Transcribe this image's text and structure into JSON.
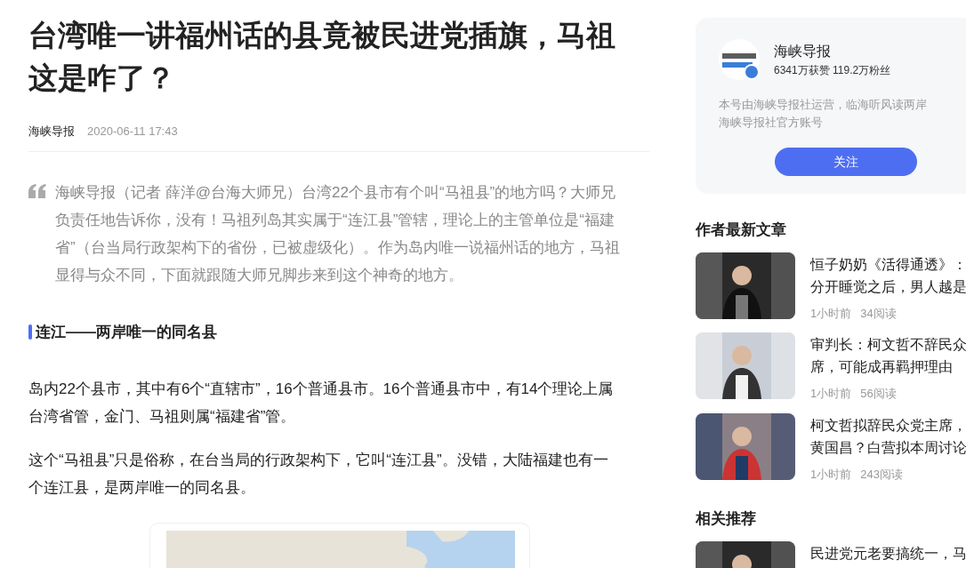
{
  "article": {
    "title": "台湾唯一讲福州话的县竟被民进党插旗，马祖这是咋了？",
    "source": "海峡导报",
    "time": "2020-06-11 17:43",
    "quote": "海峡导报（记者 薛洋@台海大师兄）台湾22个县市有个叫“马祖县”的地方吗？大师兄负责任地告诉你，没有！马祖列岛其实属于“连江县”管辖，理论上的主管单位是“福建省”（台当局行政架构下的省份，已被虚级化）。作为岛内唯一说福州话的地方，马祖显得与众不同，下面就跟随大师兄脚步来到这个神奇的地方。",
    "blocks": [
      {
        "kind": "heading",
        "text": "连江——两岸唯一的同名县"
      },
      {
        "kind": "paragraph",
        "text": "岛内22个县市，其中有6个“直辖市”，16个普通县市。16个普通县市中，有14个理论上属台湾省管，金门、马祖则属“福建省”管。"
      },
      {
        "kind": "paragraph",
        "text": "这个“马祖县”只是俗称，在台当局的行政架构下，它叫“连江县”。没错，大陆福建也有一个连江县，是两岸唯一的同名县。"
      },
      {
        "kind": "map"
      }
    ]
  },
  "author": {
    "name": "海峡导报",
    "stats": "6341万获赞 119.2万粉丝",
    "description": [
      "本号由海峡导报社运营，临海听风读两岸",
      "海峡导报社官方账号"
    ],
    "follow": "关注"
  },
  "sections": [
    {
      "title": "作者最新文章",
      "items": [
        {
          "title_lines": [
            "恒子奶奶《活得通透》：",
            "分开睡觉之后，男人越是"
          ],
          "age": "1小时前",
          "reads": "34阅读"
        },
        {
          "title_lines": [
            "审判长：柯文哲不辞民众",
            "席，可能成再羁押理由"
          ],
          "age": "1小时前",
          "reads": "56阅读"
        },
        {
          "title_lines": [
            "柯文哲拟辞民众党主席，",
            "黄国昌？白营拟本周讨论"
          ],
          "age": "1小时前",
          "reads": "243阅读"
        }
      ]
    },
    {
      "title": "相关推荐",
      "items": [
        {
          "title_lines": [
            "民进党元老要搞统一，马"
          ]
        }
      ]
    }
  ]
}
